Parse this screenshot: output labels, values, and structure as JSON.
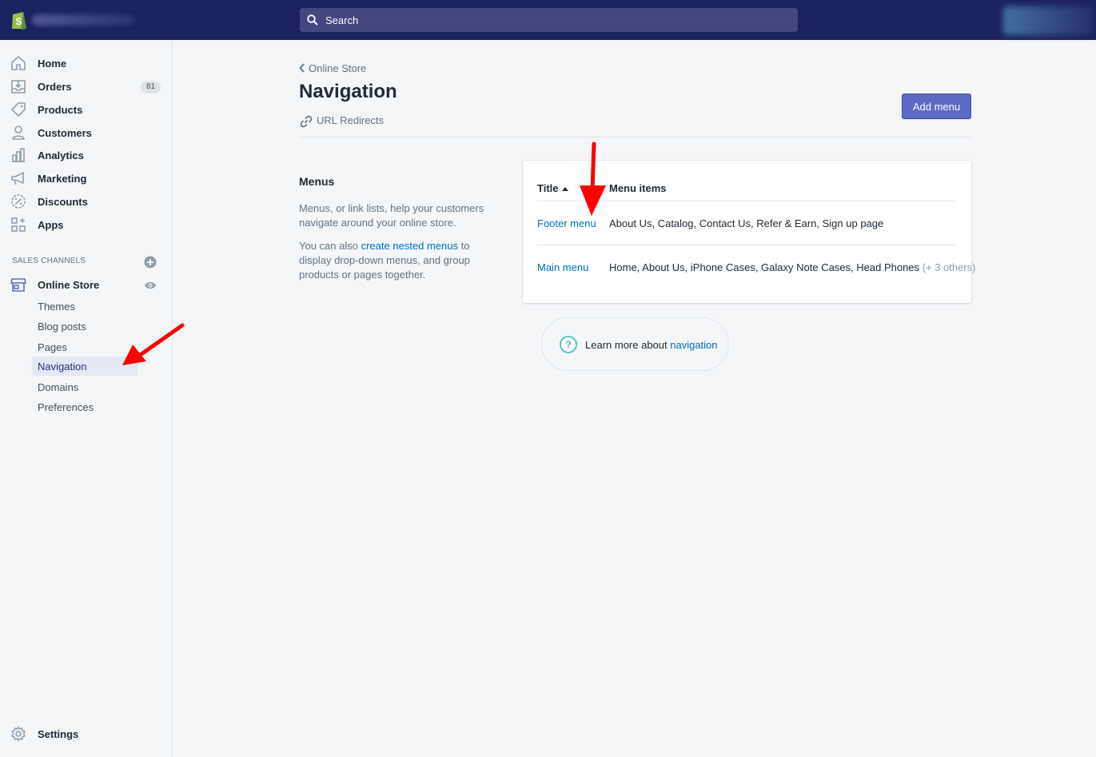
{
  "topbar": {
    "search_placeholder": "Search",
    "colors": {
      "background": "#1c2260",
      "search_bg": "#43467f"
    },
    "logo_icon": "shopify-bag-icon"
  },
  "sidebar": {
    "items": [
      {
        "label": "Home",
        "icon": "home-icon"
      },
      {
        "label": "Orders",
        "icon": "orders-icon",
        "badge": "81"
      },
      {
        "label": "Products",
        "icon": "tag-icon"
      },
      {
        "label": "Customers",
        "icon": "person-icon"
      },
      {
        "label": "Analytics",
        "icon": "bar-chart-icon"
      },
      {
        "label": "Marketing",
        "icon": "megaphone-icon"
      },
      {
        "label": "Discounts",
        "icon": "discount-icon"
      },
      {
        "label": "Apps",
        "icon": "apps-icon"
      }
    ],
    "sales_channels_heading": "SALES CHANNELS",
    "online_store": {
      "label": "Online Store",
      "icon": "store-icon"
    },
    "sub_items": [
      {
        "label": "Themes"
      },
      {
        "label": "Blog posts"
      },
      {
        "label": "Pages"
      },
      {
        "label": "Navigation",
        "active": true
      },
      {
        "label": "Domains"
      },
      {
        "label": "Preferences"
      }
    ],
    "settings": {
      "label": "Settings",
      "icon": "gear-icon"
    }
  },
  "main": {
    "breadcrumb": "Online Store",
    "title": "Navigation",
    "url_redirects": "URL Redirects",
    "add_menu_label": "Add menu",
    "section": {
      "title": "Menus",
      "description": "Menus, or link lists, help your customers navigate around your online store.",
      "description2_prefix": "You can also ",
      "description2_link": "create nested menus",
      "description2_suffix": " to display drop-down menus, and group products or pages together."
    },
    "table": {
      "headers": {
        "title": "Title",
        "items": "Menu items"
      },
      "rows": [
        {
          "title": "Footer menu",
          "items": "About Us, Catalog, Contact Us, Refer & Earn, Sign up page",
          "extra": ""
        },
        {
          "title": "Main menu",
          "items": "Home, About Us, iPhone Cases, Galaxy Note Cases, Head Phones",
          "extra": "(+ 3 others)"
        }
      ]
    },
    "learn_more": {
      "prefix": "Learn more about ",
      "link": "navigation"
    }
  },
  "colors": {
    "accent": "#5c6ac4",
    "link": "#006fbb",
    "annotation_arrow": "#ff0000"
  }
}
